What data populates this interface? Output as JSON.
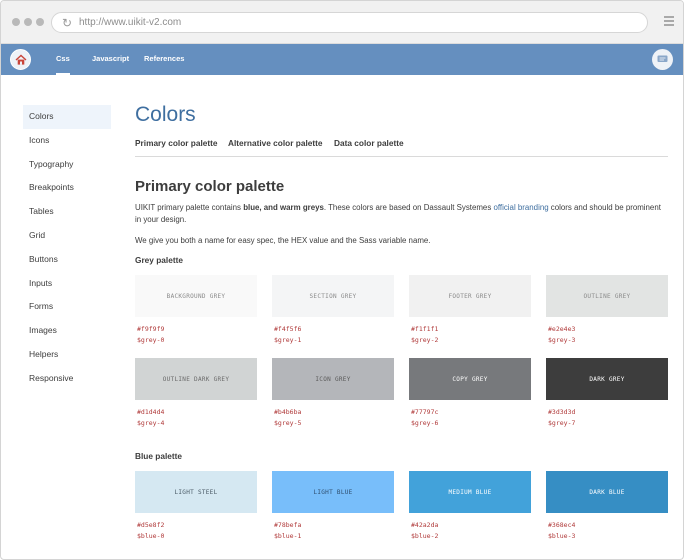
{
  "browser": {
    "url": "http://www.uikit-v2.com"
  },
  "nav": {
    "items": [
      {
        "label": "Css",
        "active": true
      },
      {
        "label": "Javascript",
        "active": false
      },
      {
        "label": "References",
        "active": false
      }
    ]
  },
  "sidebar": {
    "items": [
      {
        "label": "Colors",
        "active": true
      },
      {
        "label": "Icons"
      },
      {
        "label": "Typography"
      },
      {
        "label": "Breakpoints"
      },
      {
        "label": "Tables"
      },
      {
        "label": "Grid"
      },
      {
        "label": "Buttons"
      },
      {
        "label": "Inputs"
      },
      {
        "label": "Forms"
      },
      {
        "label": "Images"
      },
      {
        "label": "Helpers"
      },
      {
        "label": "Responsive"
      }
    ]
  },
  "main": {
    "title": "Colors",
    "tabs": [
      "Primary color palette",
      "Alternative color palette",
      "Data color palette"
    ],
    "section_title": "Primary color palette",
    "intro": {
      "part1": "UIKIT primary palette contains ",
      "bold": "blue, and warm greys",
      "part2": ". These colors are based on Dassault Systemes ",
      "link": "official branding",
      "part3": " colors and should be prominent in your design."
    },
    "intro2": "We give you both a name for easy spec, the HEX value and the Sass variable name.",
    "grey_heading": "Grey palette",
    "blue_heading": "Blue palette",
    "grey_swatches": [
      {
        "name": "BACKGROUND GREY",
        "hex": "#f9f9f9",
        "var": "$grey-0",
        "color": "#f9f9f9",
        "text_color": "#8a8a8a"
      },
      {
        "name": "SECTION GREY",
        "hex": "#f4f5f6",
        "var": "$grey-1",
        "color": "#f4f5f6",
        "text_color": "#8a8a8a"
      },
      {
        "name": "FOOTER GREY",
        "hex": "#f1f1f1",
        "var": "$grey-2",
        "color": "#f1f1f1",
        "text_color": "#8a8a8a"
      },
      {
        "name": "OUTLINE GREY",
        "hex": "#e2e4e3",
        "var": "$grey-3",
        "color": "#e2e4e3",
        "text_color": "#8a8a8a"
      },
      {
        "name": "OUTLINE DARK GREY",
        "hex": "#d1d4d4",
        "var": "$grey-4",
        "color": "#d1d4d4",
        "text_color": "#6a6a6a"
      },
      {
        "name": "ICON GREY",
        "hex": "#b4b6ba",
        "var": "$grey-5",
        "color": "#b4b6ba",
        "text_color": "#5a5a5a"
      },
      {
        "name": "COPY GREY",
        "hex": "#77797c",
        "var": "$grey-6",
        "color": "#77797c",
        "text_color": "#ffffff"
      },
      {
        "name": "DARK GREY",
        "hex": "#3d3d3d",
        "var": "$grey-7",
        "color": "#3d3d3d",
        "text_color": "#ffffff"
      }
    ],
    "blue_swatches": [
      {
        "name": "LIGHT STEEL",
        "hex": "#d5e8f2",
        "var": "$blue-0",
        "color": "#d5e8f2",
        "text_color": "#4a5a66"
      },
      {
        "name": "LIGHT BLUE",
        "hex": "#78befa",
        "var": "$blue-1",
        "color": "#78befa",
        "text_color": "#2f4f6f"
      },
      {
        "name": "MEDIUM BLUE",
        "hex": "#42a2da",
        "var": "$blue-2",
        "color": "#42a2da",
        "text_color": "#ffffff"
      },
      {
        "name": "DARK BLUE",
        "hex": "#368ec4",
        "var": "$blue-3",
        "color": "#368ec4",
        "text_color": "#ffffff"
      }
    ]
  },
  "colors": {
    "nav_bg": "#658fbf",
    "title_blue": "#3f6fa0",
    "code_red": "#b03a3a"
  },
  "icons": {
    "home": "home-icon",
    "chat": "chat-icon",
    "reload": "reload-icon",
    "menu": "hamburger-icon"
  }
}
